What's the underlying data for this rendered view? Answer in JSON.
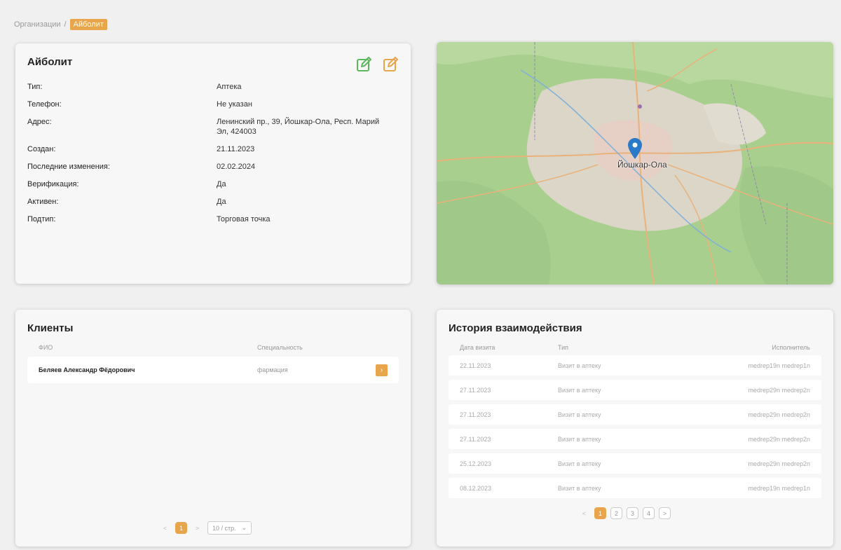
{
  "breadcrumb": {
    "parent": "Организации",
    "separator": "/",
    "current": "Айболит"
  },
  "info": {
    "title": "Айболит",
    "rows": [
      {
        "key": "Тип:",
        "value": "Аптека"
      },
      {
        "key": "Телефон:",
        "value": "Не указан"
      },
      {
        "key": "Адрес:",
        "value": "Ленинский пр., 39, Йошкар-Ола, Респ. Марий Эл, 424003"
      },
      {
        "key": "Создан:",
        "value": "21.11.2023"
      },
      {
        "key": "Последние изменения:",
        "value": "02.02.2024"
      },
      {
        "key": "Верификация:",
        "value": "Да"
      },
      {
        "key": "Активен:",
        "value": "Да"
      },
      {
        "key": "Подтип:",
        "value": "Торговая точка"
      }
    ],
    "icon_colors": {
      "edit": "#5cb85c",
      "edit_alt": "#e8a54b"
    }
  },
  "map": {
    "city_label": "Йошкар-Ола",
    "pin_color": "#2a7ac9"
  },
  "clients": {
    "title": "Клиенты",
    "columns": [
      "ФИО",
      "Специальность"
    ],
    "rows": [
      {
        "fio": "Беляев Александр Фёдорович",
        "spec": "фармация"
      }
    ],
    "pagination": {
      "prev": "<",
      "pages": [
        "1"
      ],
      "next": ">",
      "per_page": "10 / стр."
    }
  },
  "history": {
    "title": "История взаимодействия",
    "columns": [
      "Дата визита",
      "Тип",
      "Исполнитель"
    ],
    "rows": [
      {
        "date": "22.11.2023",
        "type": "Визит в аптеку",
        "user": "medrep19n medrep1n"
      },
      {
        "date": "27.11.2023",
        "type": "Визит в аптеку",
        "user": "medrep29n medrep2n"
      },
      {
        "date": "27.11.2023",
        "type": "Визит в аптеку",
        "user": "medrep29n medrep2n"
      },
      {
        "date": "27.11.2023",
        "type": "Визит в аптеку",
        "user": "medrep29n medrep2n"
      },
      {
        "date": "25.12.2023",
        "type": "Визит в аптеку",
        "user": "medrep29n medrep2n"
      },
      {
        "date": "08.12.2023",
        "type": "Визит в аптеку",
        "user": "medrep19n medrep1n"
      }
    ],
    "pagination": {
      "prev": "<",
      "pages": [
        "1",
        "2",
        "3",
        "4"
      ],
      "next": ">"
    }
  },
  "accent_color": "#e8a54b"
}
